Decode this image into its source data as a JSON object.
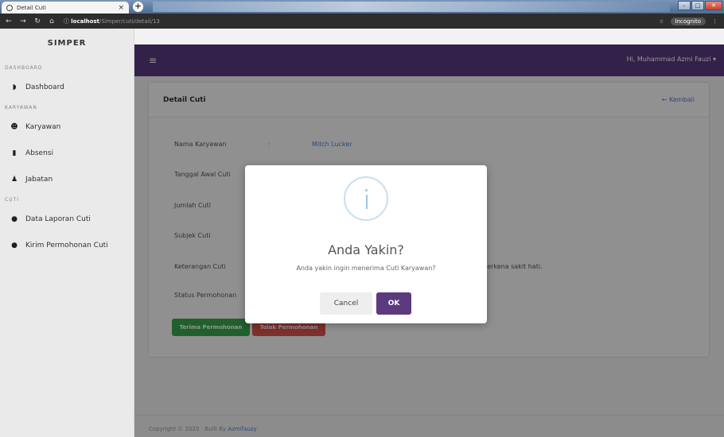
{
  "browser": {
    "tab_title": "Detail Cuti",
    "url_host": "localhost",
    "url_path": "/Simper/cuti/detail/13",
    "incognito_label": "Incognito"
  },
  "sidebar": {
    "brand": "SIMPER",
    "sections": [
      {
        "title": "DASHBOARD",
        "items": [
          {
            "label": "Dashboard",
            "icon": "dashboard-icon"
          }
        ]
      },
      {
        "title": "KARYAWAN",
        "items": [
          {
            "label": "Karyawan",
            "icon": "users-icon"
          },
          {
            "label": "Absensi",
            "icon": "book-icon"
          },
          {
            "label": "Jabatan",
            "icon": "user-tie-icon"
          }
        ]
      },
      {
        "title": "CUTI",
        "items": [
          {
            "label": "Data Laporan Cuti",
            "icon": "circle-icon"
          },
          {
            "label": "Kirim Permohonan Cuti",
            "icon": "circle-icon"
          }
        ]
      }
    ]
  },
  "topbar": {
    "menu_icon": "≡",
    "user_label": "Hi, Muhammad Azmi Fauzi ▾"
  },
  "card": {
    "title": "Detail Cuti",
    "back_label": "← Kembali",
    "fields": [
      {
        "label": "Nama Karyawan",
        "separator": ":",
        "value": "Mitch Lucker"
      },
      {
        "label": "Tanggal Awal Cuti",
        "value": ""
      },
      {
        "label": "Jumlah Cuti",
        "value": ""
      },
      {
        "label": "Subjek Cuti",
        "value": ""
      },
      {
        "label": "Keterangan Cuti",
        "value": "terkena sakit hati."
      },
      {
        "label": "Status Permohonan",
        "value": ""
      }
    ],
    "accept_button": "Terima Permohonan",
    "reject_button": "Tolak Permohonan"
  },
  "footer": {
    "text": "Copyright © 2020 · Built By ",
    "author": "Azmifauzy"
  },
  "modal": {
    "title": "Anda Yakin?",
    "message": "Anda yakin ingin menerima Cuti Karyawan?",
    "cancel_label": "Cancel",
    "ok_label": "OK"
  },
  "colors": {
    "primary": "#5b3a7e",
    "success": "#3aa64c",
    "danger": "#d9534f",
    "link": "#4a7fd6"
  }
}
